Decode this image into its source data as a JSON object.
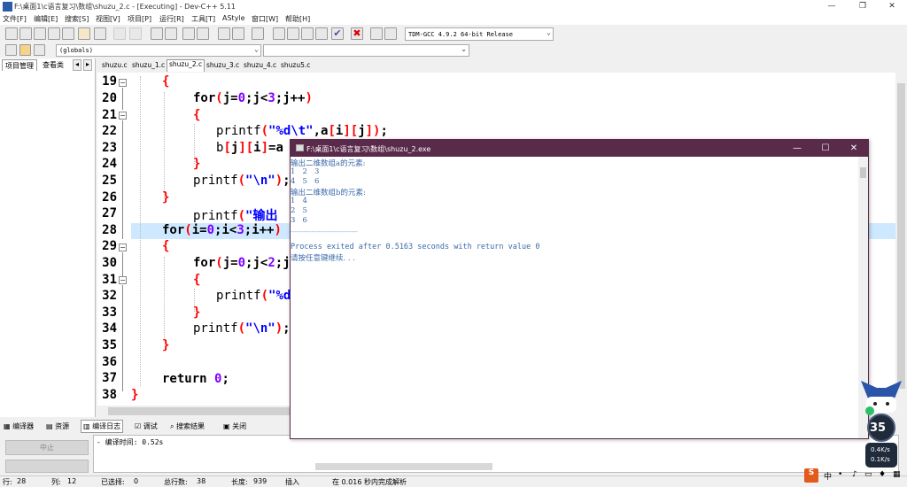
{
  "window": {
    "title": "F:\\桌面1\\c语言复习\\数组\\shuzu_2.c - [Executing] - Dev-C++ 5.11"
  },
  "menu": [
    "文件[F]",
    "编辑[E]",
    "搜索[S]",
    "视图[V]",
    "项目[P]",
    "运行[R]",
    "工具[T]",
    "AStyle",
    "窗口[W]",
    "帮助[H]"
  ],
  "toolbar": {
    "compiler": "TDM-GCC 4.9.2 64-bit Release",
    "globals": "(globals)"
  },
  "left_panel": {
    "tab_project": "项目管理",
    "tab_view": "查看类"
  },
  "file_tabs": [
    {
      "label": "shuzu.c",
      "active": false
    },
    {
      "label": "shuzu_1.c",
      "active": false
    },
    {
      "label": "shuzu_2.c",
      "active": true
    },
    {
      "label": "shuzu_3.c",
      "active": false
    },
    {
      "label": "shuzu_4.c",
      "active": false
    },
    {
      "label": "shuzu5.c",
      "active": false
    }
  ],
  "editor": {
    "line_numbers": [
      "19",
      "20",
      "21",
      "22",
      "23",
      "24",
      "25",
      "26",
      "27",
      "28",
      "29",
      "30",
      "31",
      "32",
      "33",
      "34",
      "35",
      "36",
      "37",
      "38"
    ],
    "current_line": "28"
  },
  "console": {
    "title": "F:\\桌面1\\c语言复习\\数组\\shuzu_2.exe",
    "lines": [
      "输出二维数组a的元素:",
      "1\t2\t3",
      "4\t5\t6",
      "输出二维数组b的元素:",
      "1\t4",
      "2\t5",
      "3\t6",
      "",
      "--------------------------------",
      "Process exited after 0.5163 seconds with return value 0",
      "请按任意键继续. . ."
    ]
  },
  "bottom_tabs": [
    {
      "label": "编译器",
      "icon": "grid-icon"
    },
    {
      "label": "资源",
      "icon": "resource-icon"
    },
    {
      "label": "编译日志",
      "icon": "chart-icon"
    },
    {
      "label": "调试",
      "icon": "check-icon"
    },
    {
      "label": "搜索结果",
      "icon": "search-icon"
    },
    {
      "label": "关闭",
      "icon": "close-icon"
    }
  ],
  "compile_log": {
    "stop_button": "中止",
    "text": "- 编译时间: 0.52s"
  },
  "status": {
    "row_label": "行:",
    "row": "28",
    "col_label": "列:",
    "col": "12",
    "sel_label": "已选择:",
    "sel": "0",
    "total_label": "总行数:",
    "total": "38",
    "len_label": "长度:",
    "len": "939",
    "mode": "插入",
    "parse": "在 0.016 秒内完成解析"
  },
  "gadget": {
    "percent": "35",
    "up": "0.4K/s",
    "down": "0.1K/s"
  },
  "colors": {
    "keyword": "#000000",
    "string": "#0000ff",
    "number": "#8000ff",
    "brace": "#ff0000",
    "console_title": "#5a2a4a",
    "console_text": "#3a6aa8",
    "highlight": "#cde8ff"
  }
}
